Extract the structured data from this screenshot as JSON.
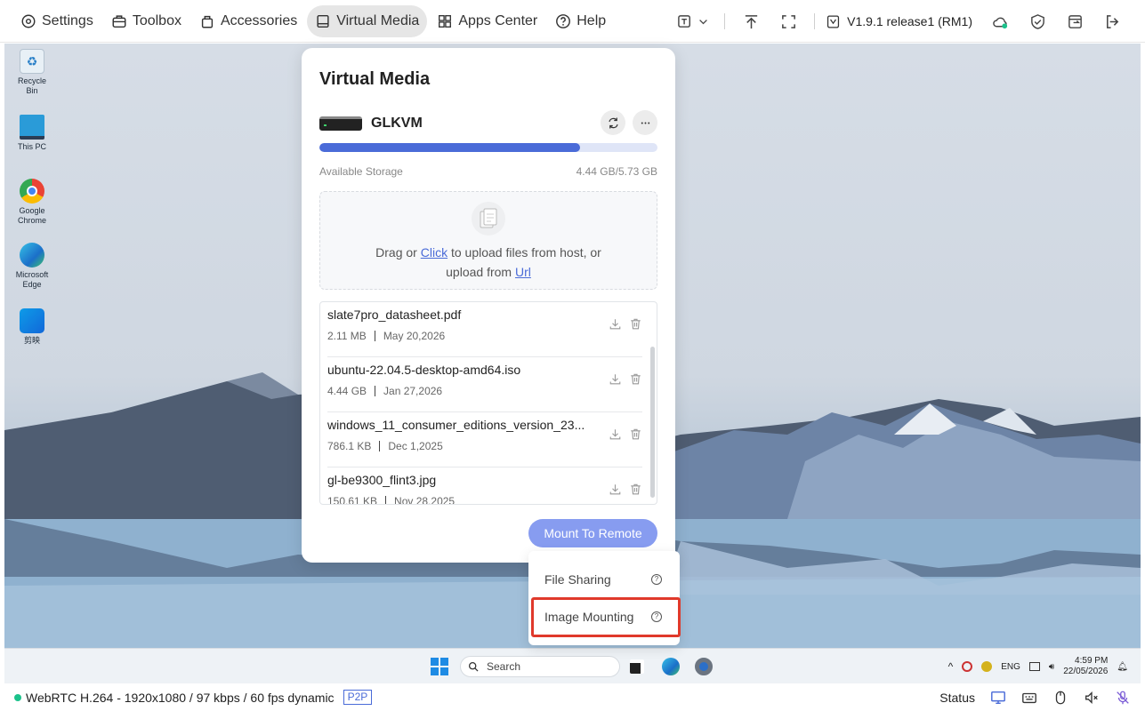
{
  "nav": {
    "items": [
      {
        "label": "Settings"
      },
      {
        "label": "Toolbox"
      },
      {
        "label": "Accessories"
      },
      {
        "label": "Virtual Media"
      },
      {
        "label": "Apps Center"
      },
      {
        "label": "Help"
      }
    ],
    "active": "Virtual Media",
    "version": "V1.9.1 release1 (RM1)"
  },
  "desktop": {
    "icons": [
      {
        "label": "Recycle Bin"
      },
      {
        "label": "This PC"
      },
      {
        "label": "Google Chrome"
      },
      {
        "label": "Microsoft Edge"
      },
      {
        "label": "剪映"
      }
    ],
    "taskbar": {
      "search_label": "Search",
      "lang": "ENG",
      "time": "4:59 PM",
      "date": "22/05/2026"
    }
  },
  "panel": {
    "title": "Virtual Media",
    "device_name": "GLKVM",
    "storage_label": "Available Storage",
    "storage_value": "4.44 GB/5.73 GB",
    "storage_used_fraction": 0.77,
    "upload": {
      "text_1": "Drag or",
      "link_click": "Click",
      "text_2": "to upload files from host, or",
      "text_3": "upload from",
      "link_url": "Url"
    },
    "files": [
      {
        "name": "slate7pro_datasheet.pdf",
        "size": "2.11 MB",
        "date": "May 20,2026"
      },
      {
        "name": "ubuntu-22.04.5-desktop-amd64.iso",
        "size": "4.44 GB",
        "date": "Jan 27,2026"
      },
      {
        "name": "windows_11_consumer_editions_version_23...",
        "size": "786.1 KB",
        "date": "Dec 1,2025"
      },
      {
        "name": "gl-be9300_flint3.jpg",
        "size": "150.61 KB",
        "date": "Nov 28,2025"
      }
    ],
    "mount_button": "Mount To Remote"
  },
  "dropdown": {
    "items": [
      {
        "label": "File Sharing",
        "help": "?"
      },
      {
        "label": "Image Mounting",
        "help": "?"
      }
    ]
  },
  "statusbar": {
    "stream": "WebRTC H.264 - 1920x1080 /  97 kbps / 60 fps dynamic",
    "mode": "P2P",
    "status_label": "Status"
  },
  "colors": {
    "accent": "#4a6bd8",
    "mount_button": "#879cf0",
    "highlight": "#e0392b",
    "online": "#1bc28b"
  }
}
